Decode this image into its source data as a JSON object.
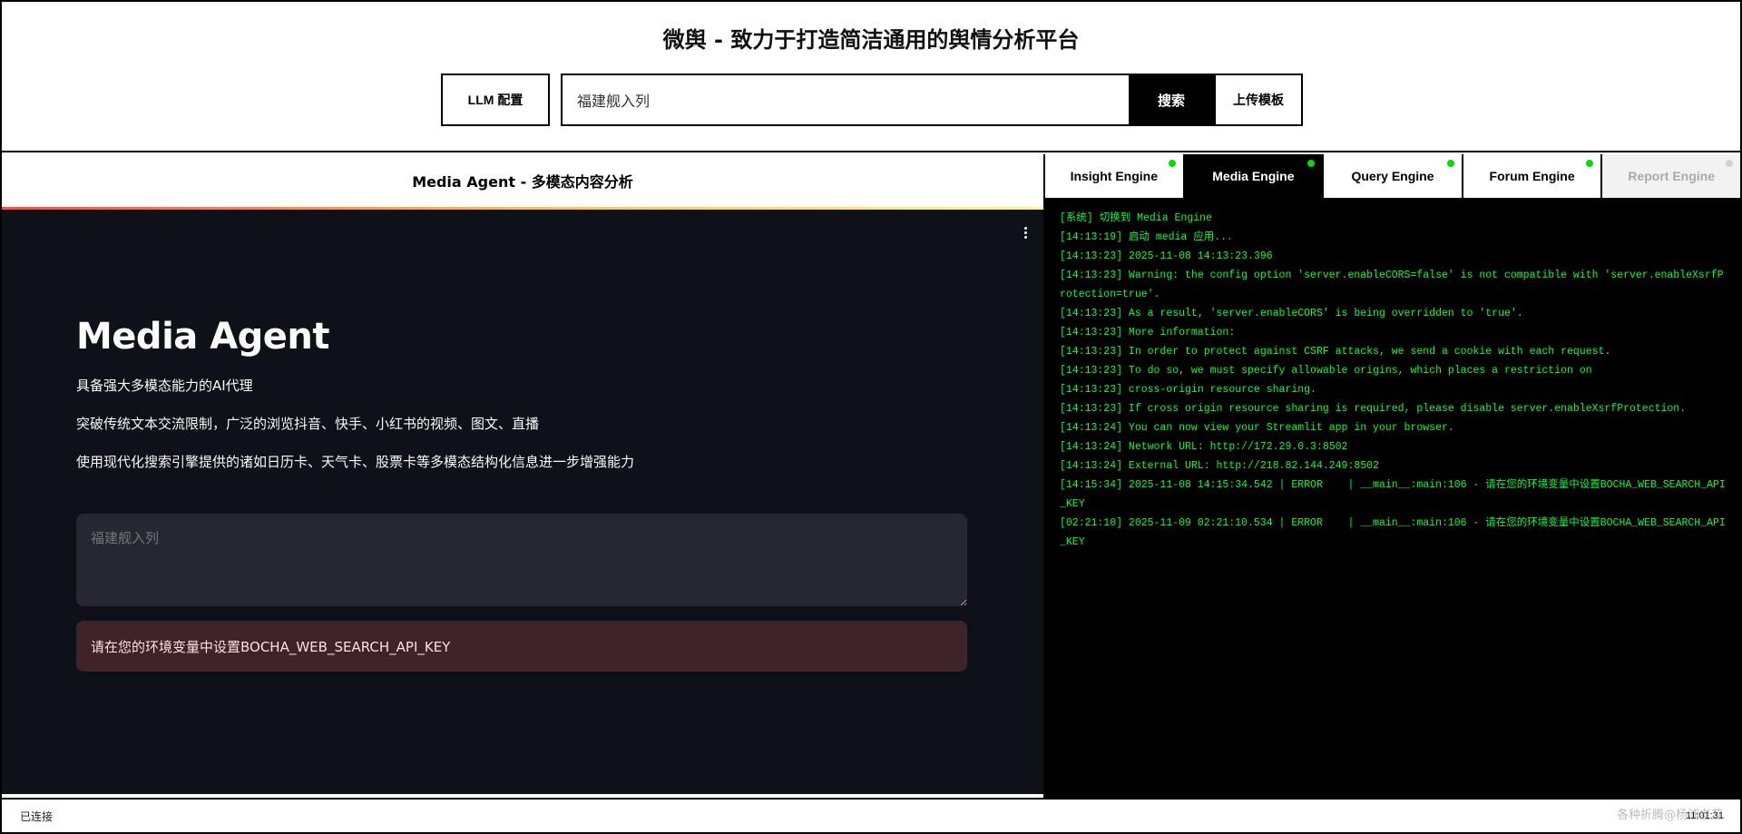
{
  "app": {
    "title": "微舆 - 致力于打造简洁通用的舆情分析平台"
  },
  "toolbar": {
    "llm_config_label": "LLM 配置",
    "search_value": "福建舰入列",
    "search_label": "搜索",
    "upload_label": "上传模板"
  },
  "left_panel": {
    "header_title": "Media Agent - 多模态内容分析",
    "agent_title": "Media Agent",
    "descriptions": [
      "具备强大多模态能力的AI代理",
      "突破传统文本交流限制，广泛的浏览抖音、快手、小红书的视频、图文、直播",
      "使用现代化搜索引擎提供的诸如日历卡、天气卡、股票卡等多模态结构化信息进一步增强能力"
    ],
    "query_placeholder": "福建舰入列",
    "error_message": "请在您的环境变量中设置BOCHA_WEB_SEARCH_API_KEY"
  },
  "tabs": [
    {
      "label": "Insight Engine",
      "state": "online"
    },
    {
      "label": "Media Engine",
      "state": "active"
    },
    {
      "label": "Query Engine",
      "state": "online"
    },
    {
      "label": "Forum Engine",
      "state": "online"
    },
    {
      "label": "Report Engine",
      "state": "disabled"
    }
  ],
  "console": {
    "lines": [
      "[系统] 切换到 Media Engine",
      "[14:13:19] 启动 media 应用...",
      "[14:13:23] 2025-11-08 14:13:23.396",
      "[14:13:23] Warning: the config option 'server.enableCORS=false' is not compatible with 'server.enableXsrfProtection=true'.",
      "[14:13:23] As a result, 'server.enableCORS' is being overridden to 'true'.",
      "[14:13:23] More information:",
      "[14:13:23] In order to protect against CSRF attacks, we send a cookie with each request.",
      "[14:13:23] To do so, we must specify allowable origins, which places a restriction on",
      "[14:13:23] cross-origin resource sharing.",
      "[14:13:23] If cross origin resource sharing is required, please disable server.enableXsrfProtection.",
      "[14:13:24] You can now view your Streamlit app in your browser.",
      "[14:13:24] Network URL: http://172.29.0.3:8502",
      "[14:13:24] External URL: http://218.82.144.249:8502",
      "[14:15:34] 2025-11-08 14:15:34.542 | ERROR    | __main__:main:106 - 请在您的环境变量中设置BOCHA_WEB_SEARCH_API_KEY",
      "[02:21:10] 2025-11-09 02:21:10.534 | ERROR    | __main__:main:106 - 请在您的环境变量中设置BOCHA_WEB_SEARCH_API_KEY"
    ]
  },
  "statusbar": {
    "connection": "已连接",
    "watermark": "各种折腾@杨浦老苏",
    "time": "11:01:31"
  },
  "colors": {
    "console_text": "#00ff33",
    "online_dot": "#00e000",
    "dark_bg": "#0e1117"
  }
}
